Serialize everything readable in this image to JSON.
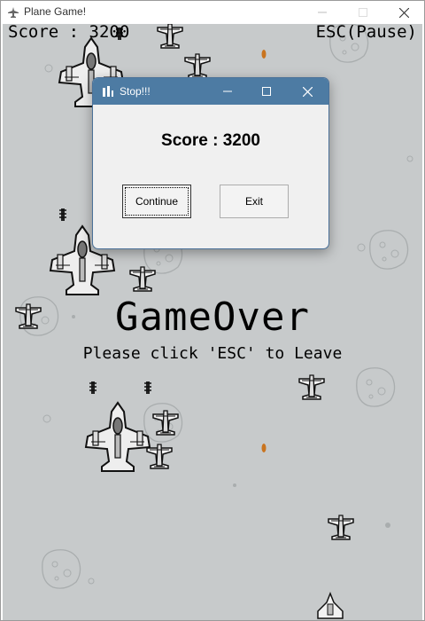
{
  "window": {
    "title": "Plane Game!",
    "icons": [
      "plane-app-icon",
      "minimize-icon",
      "maximize-icon",
      "close-icon"
    ]
  },
  "hud": {
    "score_text": "Score : 3200",
    "pause_hint": "ESC(Pause)"
  },
  "game_over": {
    "title": "GameOver",
    "message": "Please click 'ESC' to Leave"
  },
  "dialog": {
    "title": "Stop!!!",
    "score_text": "Score : 3200",
    "continue_label": "Continue",
    "exit_label": "Exit",
    "icons": [
      "dialog-app-icon",
      "minimize-icon",
      "maximize-icon",
      "close-icon"
    ]
  },
  "colors": {
    "game_background": "#c7cacb",
    "dialog_titlebar": "#4d7ba3",
    "bullet": "#c9741f"
  }
}
